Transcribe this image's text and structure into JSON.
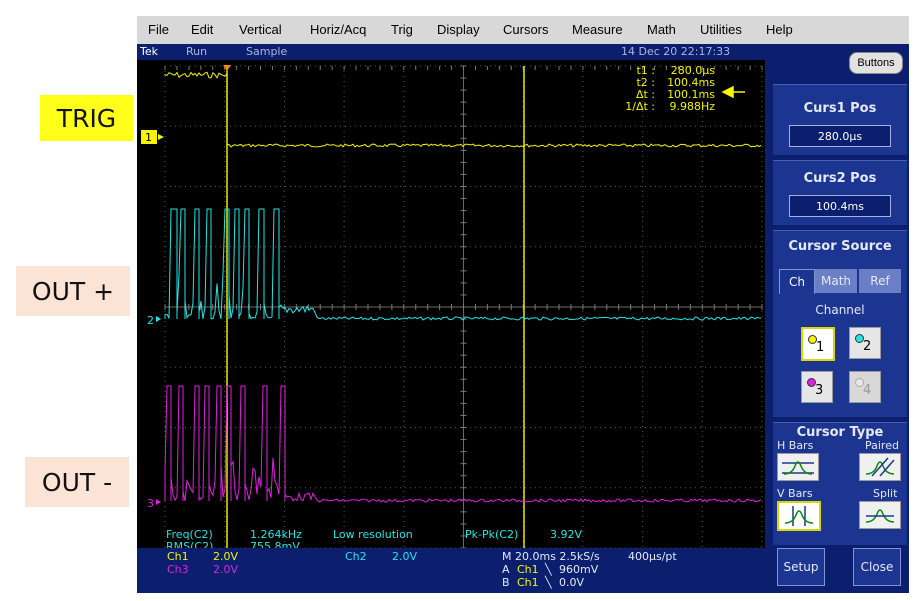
{
  "side_labels": {
    "trig": "TRIG",
    "out_plus": "OUT +",
    "out_minus": "OUT -"
  },
  "menu": [
    "File",
    "Edit",
    "Vertical",
    "Horiz/Acq",
    "Trig",
    "Display",
    "Cursors",
    "Measure",
    "Math",
    "Utilities",
    "Help"
  ],
  "status": {
    "brand": "Tek",
    "state": "Run",
    "mode": "Sample",
    "datetime": "14 Dec 20 22:17:33"
  },
  "cursor_readout": {
    "t1_label": "t1 :",
    "t1_value": "280.0µs",
    "t2_label": "t2 :",
    "t2_value": "100.4ms",
    "dt_label": "Δt :",
    "dt_value": "100.1ms",
    "inv_label": "1/Δt :",
    "inv_value": "9.988Hz"
  },
  "channel_markers": {
    "ch1": "1",
    "ch2": "2",
    "ch3": "3"
  },
  "measurements": {
    "freq_label": "Freq(C2)",
    "freq_value": "1.264kHz",
    "freq_note": "Low resolution",
    "rms_label": "RMS(C2)",
    "rms_value": "755.8mV",
    "pkpk_label": "Pk-Pk(C2)",
    "pkpk_value": "3.92V"
  },
  "settings": {
    "ch1_label": "Ch1",
    "ch1_scale": "2.0V",
    "ch3_label": "Ch3",
    "ch3_scale": "2.0V",
    "ch2_label": "Ch2",
    "ch2_scale": "2.0V",
    "horiz": "M 20.0ms 2.5kS/s",
    "pts": "400µs/pt",
    "trigA_prefix": "A",
    "trigA_src": "Ch1",
    "trigA_level": "960mV",
    "trigB_prefix": "B",
    "trigB_src": "Ch1",
    "trigB_level": "0.0V"
  },
  "panel": {
    "buttons_label": "Buttons",
    "curs1_title": "Curs1 Pos",
    "curs1_value": "280.0µs",
    "curs2_title": "Curs2 Pos",
    "curs2_value": "100.4ms",
    "source_title": "Cursor Source",
    "tabs": [
      "Ch",
      "Math",
      "Ref"
    ],
    "channel_label": "Channel",
    "channels": [
      "1",
      "2",
      "3",
      "4"
    ],
    "type_title": "Cursor Type",
    "hbars": "H Bars",
    "paired": "Paired",
    "vbars": "V Bars",
    "split": "Split",
    "setup": "Setup",
    "close": "Close"
  },
  "colors": {
    "ch1": "#f5f500",
    "ch2": "#22e6e6",
    "ch3": "#e020e0",
    "cursor": "#e8e800",
    "panel": "#0b1f6e"
  },
  "icons": {
    "trig_arrow": "triangle-marker-icon",
    "readout_arrow": "left-arrow-icon"
  }
}
